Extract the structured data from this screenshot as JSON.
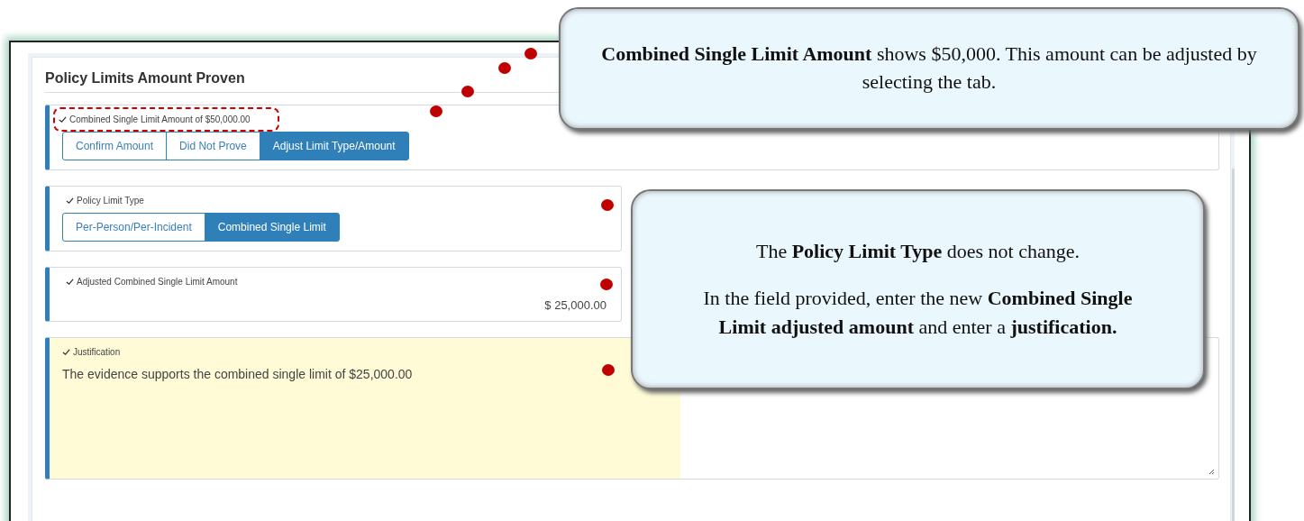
{
  "panel": {
    "title": "Policy Limits Amount Proven"
  },
  "sections": [
    {
      "kind": "options",
      "label": "Combined Single Limit Amount of $50,000.00",
      "highlighted": true,
      "options": [
        {
          "label": "Confirm Amount",
          "selected": false
        },
        {
          "label": "Did Not Prove",
          "selected": false
        },
        {
          "label": "Adjust Limit Type/Amount",
          "selected": true
        }
      ]
    },
    {
      "kind": "options",
      "label": "Policy Limit Type",
      "highlighted": false,
      "options": [
        {
          "label": "Per-Person/Per-Incident",
          "selected": false
        },
        {
          "label": "Combined Single Limit",
          "selected": true
        }
      ]
    },
    {
      "kind": "amount",
      "label": "Adjusted Combined Single Limit Amount",
      "value": "$ 25,000.00"
    },
    {
      "kind": "textarea",
      "label": "Justification",
      "value": "The evidence supports the combined single limit of $25,000.00"
    }
  ],
  "callouts": [
    {
      "paragraphs": [
        "**Combined Single Limit Amount** shows $50,000. This amount can be adjusted by selecting the tab."
      ]
    },
    {
      "paragraphs": [
        "The **Policy Limit Type** does not change.",
        "In the field provided, enter the new **Combined Single Limit adjusted amount** and enter a **justification.**"
      ]
    }
  ]
}
